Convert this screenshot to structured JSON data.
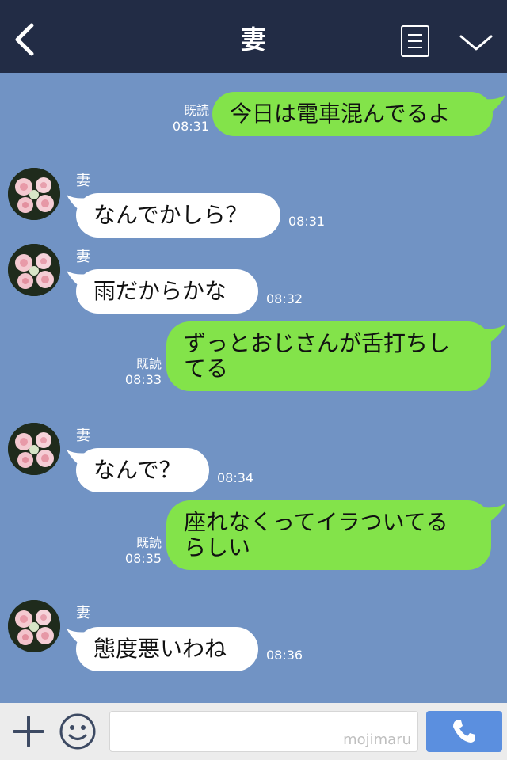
{
  "header": {
    "title": "妻",
    "back_icon": "chevron-left-icon",
    "menu_icon": "document-menu-icon",
    "collapse_icon": "chevron-down-icon"
  },
  "messages": [
    {
      "side": "right",
      "text_lines": [
        "今日は電車混んでるよ"
      ],
      "read": "既読",
      "time": "08:31"
    },
    {
      "side": "left",
      "sender": "妻",
      "text_lines": [
        "なんでかしら？"
      ],
      "time": "08:31"
    },
    {
      "side": "left",
      "sender": "妻",
      "text_lines": [
        "雨だからかな"
      ],
      "time": "08:32"
    },
    {
      "side": "right",
      "text_lines": [
        "ずっとおじさんが舌打ちし",
        "てる"
      ],
      "read": "既読",
      "time": "08:33"
    },
    {
      "side": "left",
      "sender": "妻",
      "text_lines": [
        "なんで？"
      ],
      "time": "08:34"
    },
    {
      "side": "right",
      "text_lines": [
        "座れなくってイラついてる",
        "らしい"
      ],
      "read": "既読",
      "time": "08:35"
    },
    {
      "side": "left",
      "sender": "妻",
      "text_lines": [
        "態度悪いわね"
      ],
      "time": "08:36"
    }
  ],
  "footer": {
    "watermark": "mojimaru",
    "plus_icon": "plus-icon",
    "emoji_icon": "smiley-icon",
    "call_icon": "phone-icon"
  },
  "colors": {
    "header_bg": "#222c45",
    "chat_bg": "#7193c4",
    "sent_bubble": "#83e34a",
    "received_bubble": "#ffffff",
    "call_button": "#5b8fdf"
  }
}
